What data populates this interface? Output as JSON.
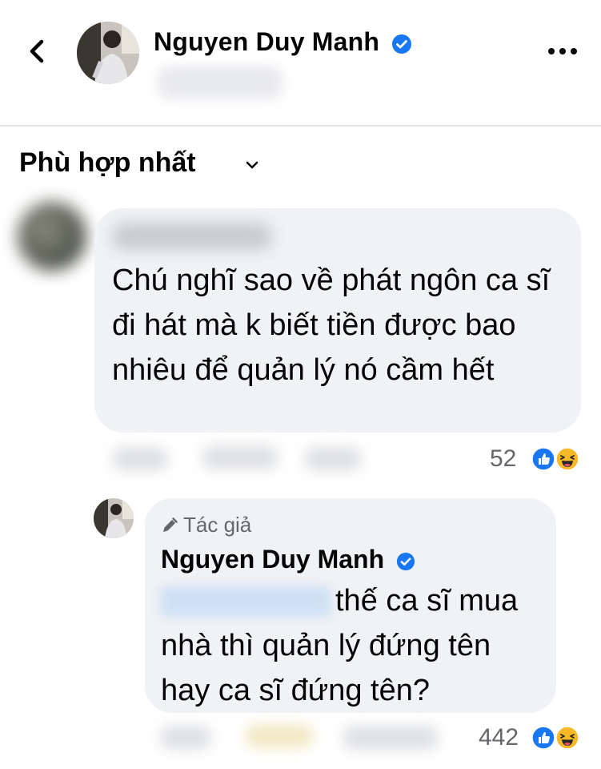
{
  "header": {
    "back_icon": "chevron-left-icon",
    "name": "Nguyen Duy Manh",
    "verified_icon": "verified-badge-icon",
    "more_icon": "more-horizontal-icon"
  },
  "sort": {
    "label": "Phù hợp nhất",
    "chevron_icon": "chevron-down-icon"
  },
  "comments": [
    {
      "text": "Chú nghĩ sao về phát ngôn ca sĩ đi hát mà k biết tiền được bao nhiêu để quản lý nó cầm hết",
      "reaction_count": "52",
      "reaction_icons": [
        "like-icon",
        "haha-icon"
      ]
    }
  ],
  "reply": {
    "author_badge": "Tác giả",
    "author_badge_icon": "pencil-icon",
    "name": "Nguyen Duy Manh",
    "text": "thế ca sĩ mua nhà thì quản lý đứng tên hay ca sĩ đứng tên?",
    "reaction_count": "442",
    "reaction_icons": [
      "like-icon",
      "haha-icon"
    ]
  },
  "colors": {
    "bubble": "#f0f2f5",
    "verified": "#1877f2",
    "like": "#1877f2",
    "haha": "#f7b928",
    "secondary_text": "#65676b"
  }
}
